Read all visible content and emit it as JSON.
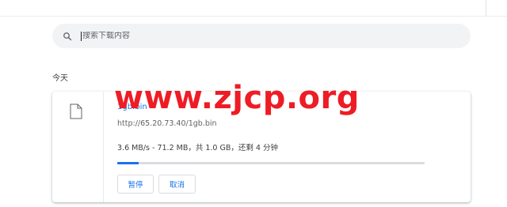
{
  "search": {
    "placeholder": "搜索下载内容",
    "icon": "search-icon"
  },
  "section": {
    "heading": "今天"
  },
  "download": {
    "file_name": "1gb.bin",
    "url": "http://65.20.73.40/1gb.bin",
    "status": "3.6 MB/s - 71.2 MB，共 1.0 GB，还剩 4 分钟",
    "progress_fraction": 0.07,
    "file_icon": "file-icon",
    "pause_label": "暂停",
    "cancel_label": "取消"
  },
  "watermark": {
    "text": "www.zjcp.org"
  },
  "colors": {
    "accent": "#1a73e8",
    "watermark": "#ee1c25"
  }
}
